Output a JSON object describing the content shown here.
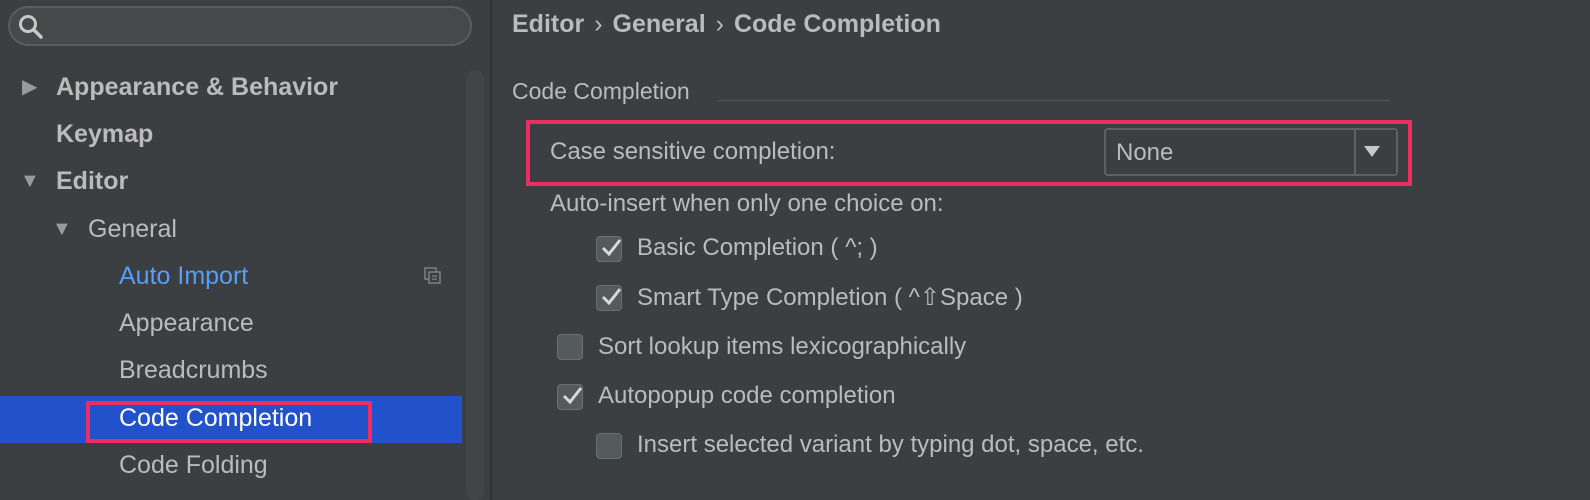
{
  "search": {
    "placeholder": "",
    "icon": "search-icon"
  },
  "tree": {
    "appearance_behavior": "Appearance & Behavior",
    "keymap": "Keymap",
    "editor": "Editor",
    "general": "General",
    "auto_import": "Auto Import",
    "appearance": "Appearance",
    "breadcrumbs": "Breadcrumbs",
    "code_completion": "Code Completion",
    "code_folding": "Code Folding"
  },
  "breadcrumb": {
    "part1": "Editor",
    "part2": "General",
    "part3": "Code Completion",
    "separator": "›"
  },
  "settings": {
    "section_title": "Code Completion",
    "case_sensitive_label": "Case sensitive completion:",
    "case_sensitive_value": "None",
    "auto_insert_label": "Auto-insert when only one choice on:",
    "basic_completion": "Basic Completion ( ^; )",
    "smart_completion": "Smart Type Completion ( ^⇧Space )",
    "sort_lookup": "Sort lookup items lexicographically",
    "autopopup": "Autopopup code completion",
    "insert_selected": "Insert selected variant by typing dot, space, etc."
  },
  "colors": {
    "background": "#3c3f41",
    "selection": "#2251cc",
    "highlight": "#ee2d63",
    "link": "#589df6"
  }
}
